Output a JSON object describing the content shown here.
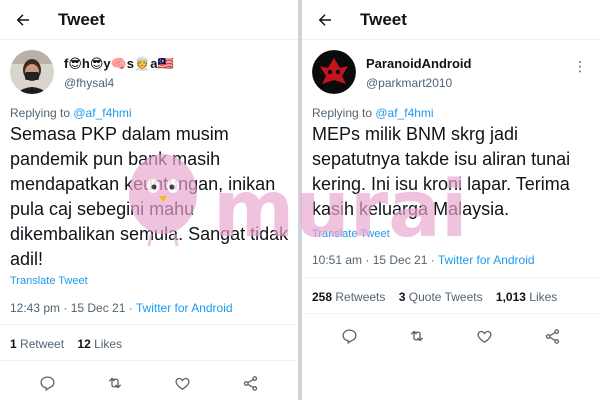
{
  "colors": {
    "accent": "#1d9bf0",
    "muted": "#536471",
    "text": "#0f1419",
    "watermark": "#e8a6cf"
  },
  "left": {
    "header": {
      "title": "Tweet"
    },
    "author": {
      "name": "f😎h😎y🧠s👳a🇲🇾",
      "handle": "@fhysal4"
    },
    "replying": {
      "prefix": "Replying to ",
      "handle": "@af_f4hmi"
    },
    "body": "Semasa PKP dalam musim pandemik pun bank masih mendapatkan keuntungan, inikan pula caj sebegini mahu dikembalikan semula. Sangat tidak adil!",
    "translate": "Translate Tweet",
    "meta": {
      "time": "12:43 pm · 15 Dec 21 · ",
      "source": "Twitter for Android"
    },
    "stats": {
      "retweets_count": "1",
      "retweets_label": " Retweet",
      "likes_count": "12",
      "likes_label": " Likes"
    }
  },
  "right": {
    "header": {
      "title": "Tweet"
    },
    "author": {
      "name": "ParanoidAndroid",
      "handle": "@parkmart2010"
    },
    "more": "⋮",
    "replying": {
      "prefix": "Replying to ",
      "handle": "@af_f4hmi"
    },
    "body": "MEPs milik BNM skrg jadi sepatutnya takde isu aliran tunai kering. Ini isu kroni lapar. Terima kasih keluarga Malaysia.",
    "translate": "Translate Tweet",
    "meta": {
      "time": "10:51 am · 15 Dec 21 · ",
      "source": "Twitter for Android"
    },
    "stats": {
      "retweets_count": "258",
      "retweets_label": " Retweets",
      "quotes_count": "3",
      "quotes_label": " Quote Tweets",
      "likes_count": "1,013",
      "likes_label": " Likes"
    }
  },
  "watermark": {
    "text": "murai"
  },
  "icons": [
    "back-arrow-icon",
    "reply-icon",
    "retweet-icon",
    "like-icon",
    "share-icon",
    "more-icon"
  ]
}
